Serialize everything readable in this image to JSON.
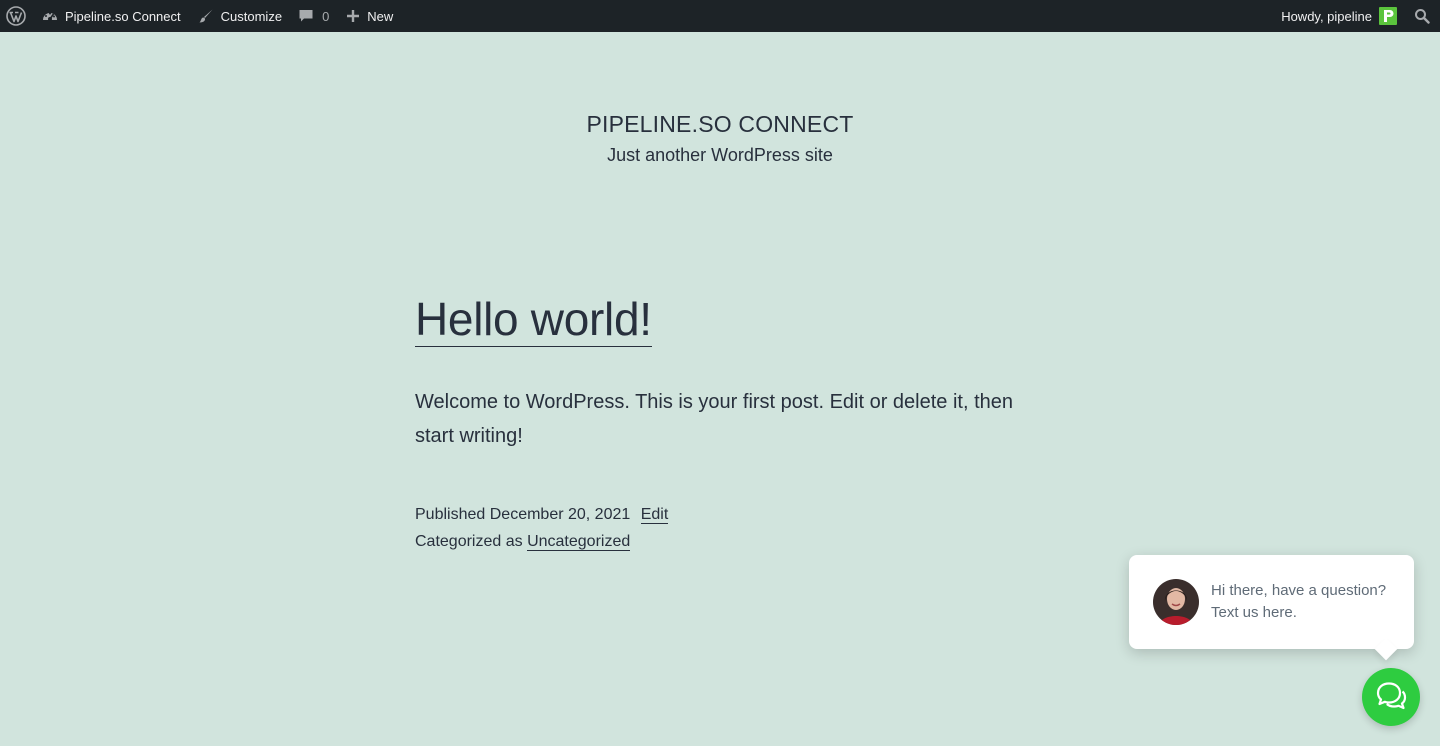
{
  "adminbar": {
    "wp_logo_icon": "wordpress-logo-icon",
    "site_name": "Pipeline.so Connect",
    "customize_label": "Customize",
    "comments_count": "0",
    "new_label": "New",
    "howdy_label": "Howdy, pipeline",
    "avatar_letter": "p",
    "avatar_color": "#5bc43d"
  },
  "site": {
    "title": "PIPELINE.SO CONNECT",
    "description": "Just another WordPress site"
  },
  "post": {
    "title": "Hello world!",
    "content": "Welcome to WordPress. This is your first post. Edit or delete it, then start writing!",
    "published_prefix": "Published",
    "published_date": "December 20, 2021",
    "edit_label": "Edit",
    "categorized_prefix": "Categorized as",
    "category": "Uncategorized"
  },
  "chat": {
    "message": "Hi there, have a question? Text us here.",
    "button_color": "#2ecc40"
  },
  "colors": {
    "background": "#d1e4dd",
    "adminbar": "#1d2327",
    "text": "#28303d"
  }
}
